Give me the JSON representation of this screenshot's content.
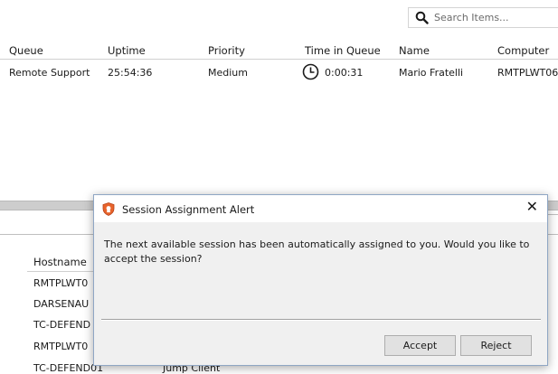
{
  "search": {
    "placeholder": "Search Items..."
  },
  "queue_table": {
    "headers": [
      "Queue",
      "Uptime",
      "Priority",
      "Time in Queue",
      "Name",
      "Computer"
    ],
    "rows": [
      {
        "queue": "Remote Support",
        "uptime": "25:54:36",
        "priority": "Medium",
        "time_in_queue": "0:00:31",
        "name": "Mario Fratelli",
        "computer": "RMTPLWT06"
      }
    ]
  },
  "lower_table": {
    "header": "Hostname",
    "rows": [
      "RMTPLWT0",
      "DARSENAU",
      "TC-DEFEND",
      "RMTPLWT0",
      "TC-DEFEND01"
    ],
    "partial_text": "Jump Client"
  },
  "dialog": {
    "title": "Session Assignment Alert",
    "message": "The next available session has been automatically assigned to you.  Would you like to accept the session?",
    "close_glyph": "✕",
    "accept_label": "Accept",
    "reject_label": "Reject"
  },
  "colors": {
    "shield": "#e8642c",
    "dialog_bg": "#f0f0f0",
    "button_bg": "#e1e1e1"
  }
}
